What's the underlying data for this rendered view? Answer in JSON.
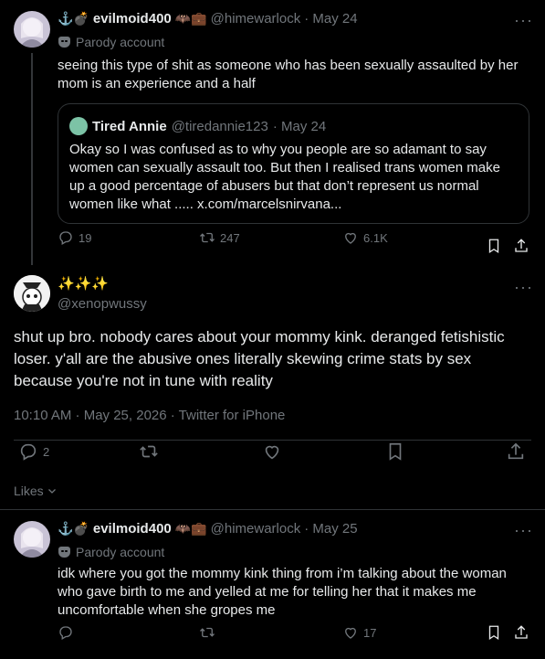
{
  "tweet1": {
    "emojis": "⚓💣",
    "display_name": "evilmoid400",
    "badges": "🦇💼",
    "handle": "@himewarlock",
    "date": "· May 24",
    "parody": "Parody account",
    "text": "seeing this type of shit as someone who has been sexually assaulted by her mom is an experience and a half",
    "quote": {
      "display_name": "Tired Annie",
      "handle": "@tiredannie123",
      "date": "· May 24",
      "text": "Okay so I was confused as to why you people are so adamant to say women can sexually assault too. But then I realised trans women make up a good percentage of abusers but that don’t represent us normal women like what ..... x.com/marcelsnirvana..."
    },
    "replies": "19",
    "retweets": "247",
    "likes": "6.1K"
  },
  "tweet2": {
    "display_name": "✨✨✨",
    "handle": "@xenopwussy",
    "text": "shut up bro. nobody cares about your mommy kink. deranged fetishistic loser. y'all are the abusive ones literally skewing crime stats by sex because you're not in tune with reality",
    "timestamp": "10:10 AM · May 25, 2026 · Twitter for iPhone",
    "replies": "2",
    "likes_link": "Likes"
  },
  "tweet3": {
    "emojis": "⚓💣",
    "display_name": "evilmoid400",
    "badges": "🦇💼",
    "handle": "@himewarlock",
    "date": "· May 25",
    "parody": "Parody account",
    "text": "idk where you got the mommy kink thing from i’m talking about the woman who gave birth to me and yelled at me for telling her that it makes me uncomfortable when she gropes me",
    "likes": "17"
  },
  "colors": {
    "background": "#000000",
    "text": "#e7e9ea",
    "muted": "#71767b",
    "border": "#2f3336"
  },
  "icons": [
    "reply-icon",
    "retweet-icon",
    "like-icon",
    "bookmark-icon",
    "share-icon",
    "more-icon",
    "parody-mask-icon",
    "chevron-down-icon"
  ]
}
